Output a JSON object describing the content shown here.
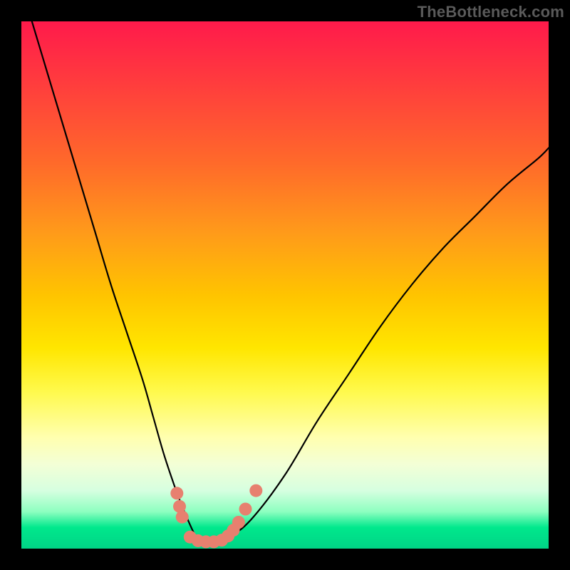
{
  "watermark": "TheBottleneck.com",
  "chart_data": {
    "type": "line",
    "title": "",
    "xlabel": "",
    "ylabel": "",
    "xlim": [
      0,
      100
    ],
    "ylim": [
      0,
      100
    ],
    "series": [
      {
        "name": "bottleneck-curve",
        "x": [
          2,
          5,
          8,
          11,
          14,
          17,
          20,
          23,
          25,
          27,
          29,
          30.5,
          32,
          33,
          34,
          35,
          37,
          40,
          44,
          50,
          56,
          62,
          68,
          74,
          80,
          86,
          92,
          98,
          100
        ],
        "y": [
          100,
          90,
          80,
          70,
          60,
          50,
          41,
          32,
          25,
          18,
          12,
          8,
          4.5,
          2.5,
          1.5,
          1.3,
          1.3,
          2.5,
          6,
          14,
          24,
          33,
          42,
          50,
          57,
          63,
          69,
          74,
          76
        ]
      }
    ],
    "markers": {
      "name": "highlight-dots",
      "color": "#e7806f",
      "points": [
        {
          "x": 29.5,
          "y": 10.5
        },
        {
          "x": 30.0,
          "y": 8.0
        },
        {
          "x": 30.5,
          "y": 6.0
        },
        {
          "x": 32.0,
          "y": 2.2
        },
        {
          "x": 33.5,
          "y": 1.5
        },
        {
          "x": 35.0,
          "y": 1.3
        },
        {
          "x": 36.5,
          "y": 1.3
        },
        {
          "x": 38.0,
          "y": 1.6
        },
        {
          "x": 39.2,
          "y": 2.4
        },
        {
          "x": 40.2,
          "y": 3.5
        },
        {
          "x": 41.2,
          "y": 5.0
        },
        {
          "x": 42.5,
          "y": 7.5
        },
        {
          "x": 44.5,
          "y": 11.0
        }
      ]
    }
  }
}
